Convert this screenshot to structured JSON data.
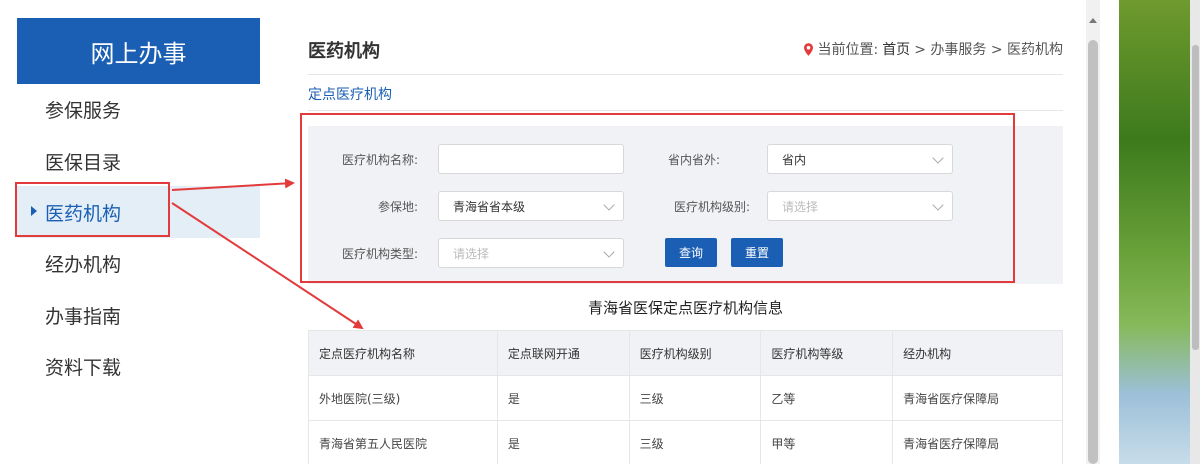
{
  "sidebar": {
    "title": "网上办事",
    "items": [
      {
        "label": "参保服务"
      },
      {
        "label": "医保目录"
      },
      {
        "label": "医药机构"
      },
      {
        "label": "经办机构"
      },
      {
        "label": "办事指南"
      },
      {
        "label": "资料下载"
      }
    ]
  },
  "header": {
    "title": "医药机构",
    "breadcrumb_prefix": "当前位置:",
    "breadcrumb_home": "首页",
    "breadcrumb_rest": "> 办事服务 > 医药机构"
  },
  "tabs": [
    {
      "label": "定点医疗机构"
    }
  ],
  "form": {
    "name_label": "医疗机构名称:",
    "name_value": "",
    "region_label": "省内省外:",
    "region_value": "省内",
    "insured_label": "参保地:",
    "insured_value": "青海省省本级",
    "level_label": "医疗机构级别:",
    "level_placeholder": "请选择",
    "type_label": "医疗机构类型:",
    "type_placeholder": "请选择",
    "search_label": "查询",
    "reset_label": "重置"
  },
  "table": {
    "title": "青海省医保定点医疗机构信息",
    "columns": [
      "定点医疗机构名称",
      "定点联网开通",
      "医疗机构级别",
      "医疗机构等级",
      "经办机构"
    ],
    "rows": [
      [
        "外地医院(三级)",
        "是",
        "三级",
        "乙等",
        "青海省医疗保障局"
      ],
      [
        "青海省第五人民医院",
        "是",
        "三级",
        "甲等",
        "青海省医疗保障局"
      ]
    ]
  },
  "colors": {
    "accent": "#1a5fb4",
    "annotation": "#e33b3b"
  },
  "icons": [
    "location-pin-icon",
    "chevron-down-icon",
    "caret-right-icon"
  ]
}
